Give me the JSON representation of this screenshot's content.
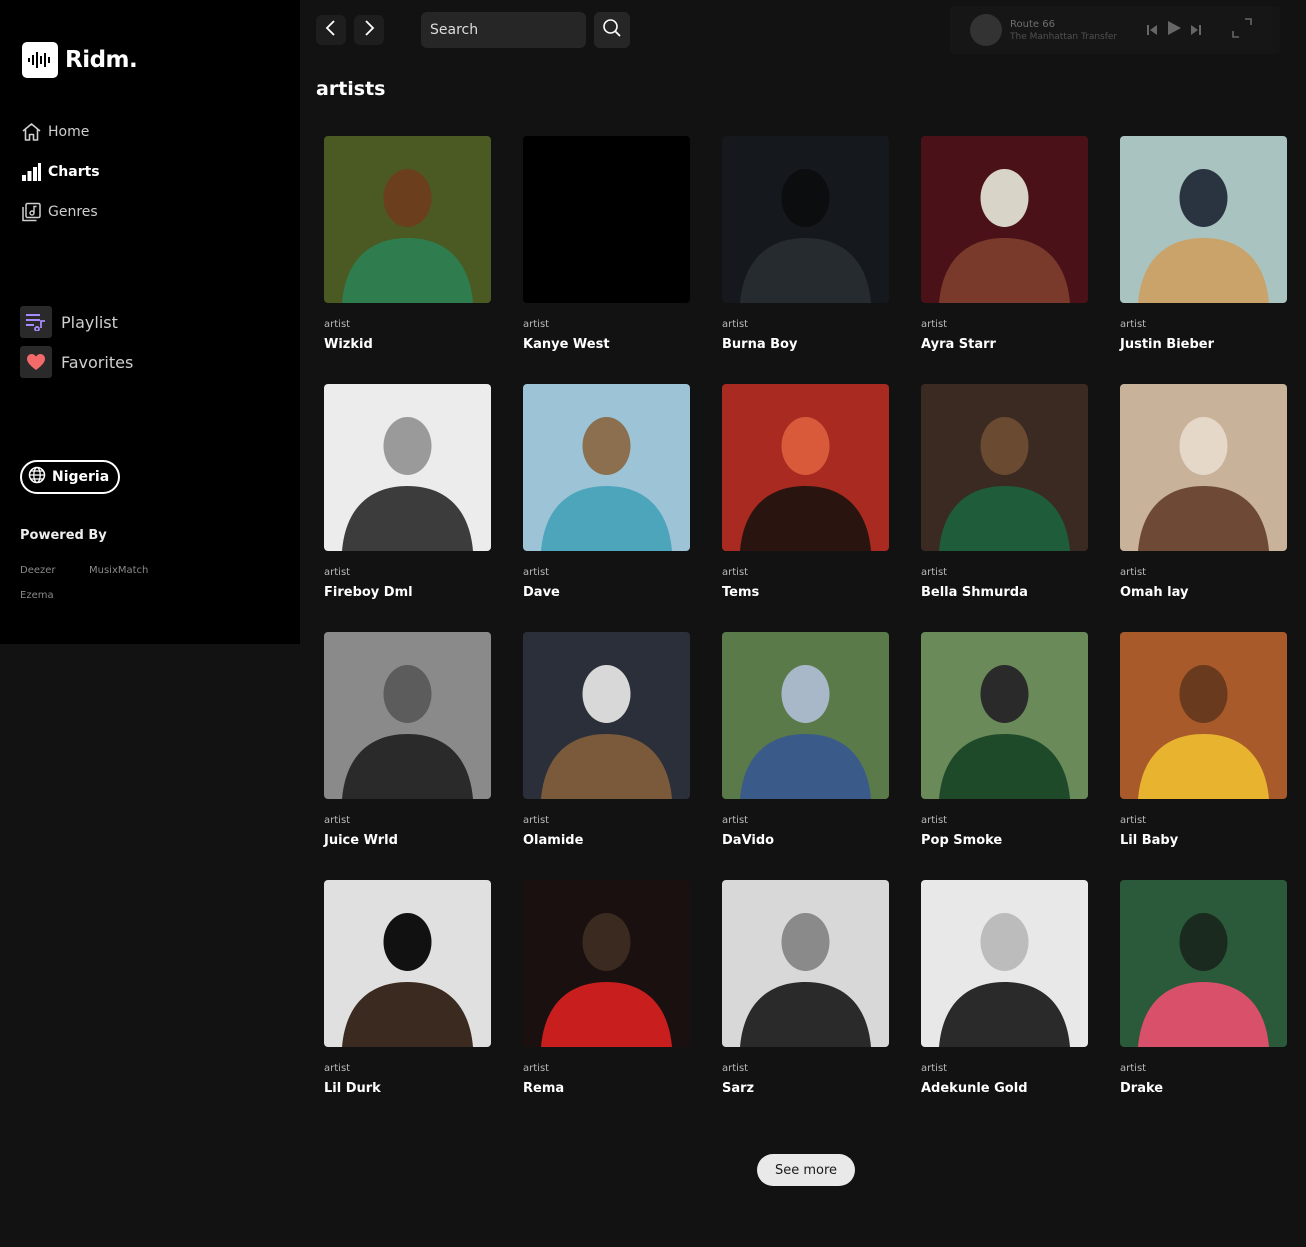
{
  "app": {
    "name": "Ridm."
  },
  "nav": [
    {
      "label": "Home",
      "icon": "home-icon",
      "active": false
    },
    {
      "label": "Charts",
      "icon": "charts-icon",
      "active": true
    },
    {
      "label": "Genres",
      "icon": "genres-icon",
      "active": false
    }
  ],
  "library": [
    {
      "label": "Playlist",
      "icon": "playlist-icon",
      "color": "#a78bfa"
    },
    {
      "label": "Favorites",
      "icon": "heart-icon",
      "color": "#f26a6a"
    }
  ],
  "country": {
    "label": "Nigeria"
  },
  "powered_by": {
    "heading": "Powered By",
    "providers": [
      "Deezer",
      "MusixMatch",
      "Ezema"
    ]
  },
  "search": {
    "placeholder": "Search"
  },
  "player": {
    "title": "Route 66",
    "artist": "The Manhattan Transfer"
  },
  "section": {
    "title": "artists"
  },
  "artists": [
    {
      "type": "artist",
      "name": "Wizkid",
      "colors": [
        "#4a5a22",
        "#2f7d4f",
        "#6b3f1e"
      ]
    },
    {
      "type": "artist",
      "name": "Kanye West",
      "colors": [
        "#000000",
        "#000000",
        "#000000"
      ]
    },
    {
      "type": "artist",
      "name": "Burna Boy",
      "colors": [
        "#15191d",
        "#262b30",
        "#0b0d0f"
      ]
    },
    {
      "type": "artist",
      "name": "Ayra Starr",
      "colors": [
        "#4a1218",
        "#7a3a2b",
        "#d9d4c8"
      ]
    },
    {
      "type": "artist",
      "name": "Justin Bieber",
      "colors": [
        "#a9c4c0",
        "#c9a36a",
        "#2a3440"
      ]
    },
    {
      "type": "artist",
      "name": "Fireboy Dml",
      "colors": [
        "#ececec",
        "#3c3c3c",
        "#9a9a9a"
      ]
    },
    {
      "type": "artist",
      "name": "Dave",
      "colors": [
        "#9cc4d6",
        "#4da5bc",
        "#8b6f4e"
      ]
    },
    {
      "type": "artist",
      "name": "Tems",
      "colors": [
        "#a82a20",
        "#2a1410",
        "#d85a3a"
      ]
    },
    {
      "type": "artist",
      "name": "Bella Shmurda",
      "colors": [
        "#3a2a22",
        "#1e5c3a",
        "#6a4a30"
      ]
    },
    {
      "type": "artist",
      "name": "Omah lay",
      "colors": [
        "#c9b29a",
        "#6e4a36",
        "#e6d8c8"
      ]
    },
    {
      "type": "artist",
      "name": "Juice Wrld",
      "colors": [
        "#8a8a8a",
        "#2a2a2a",
        "#5c5c5c"
      ]
    },
    {
      "type": "artist",
      "name": "Olamide",
      "colors": [
        "#2a2f3a",
        "#7a5a3a",
        "#d8d8d8"
      ]
    },
    {
      "type": "artist",
      "name": "DaVido",
      "colors": [
        "#5a7a4a",
        "#3a5a8a",
        "#a9b8c8"
      ]
    },
    {
      "type": "artist",
      "name": "Pop Smoke",
      "colors": [
        "#6a8a5a",
        "#1e4a2a",
        "#2a2a2a"
      ]
    },
    {
      "type": "artist",
      "name": "Lil Baby",
      "colors": [
        "#a85a2a",
        "#e8b430",
        "#6a3a1e"
      ]
    },
    {
      "type": "artist",
      "name": "Lil Durk",
      "colors": [
        "#e0e0e0",
        "#3a2a20",
        "#111111"
      ]
    },
    {
      "type": "artist",
      "name": "Rema",
      "colors": [
        "#1a1010",
        "#c81e1e",
        "#3a2a20"
      ]
    },
    {
      "type": "artist",
      "name": "Sarz",
      "colors": [
        "#d8d8d8",
        "#2a2a2a",
        "#8a8a8a"
      ]
    },
    {
      "type": "artist",
      "name": "Adekunle Gold",
      "colors": [
        "#e8e8e8",
        "#2a2a2a",
        "#bcbcbc"
      ]
    },
    {
      "type": "artist",
      "name": "Drake",
      "colors": [
        "#2a5a3a",
        "#d8506a",
        "#1a2a1e"
      ]
    }
  ],
  "see_more": {
    "label": "See more"
  }
}
